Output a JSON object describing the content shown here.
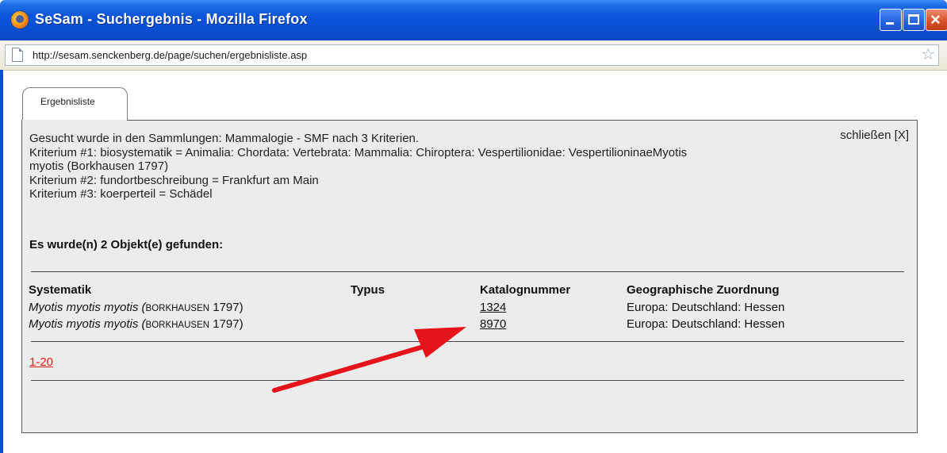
{
  "window": {
    "title": "SeSam - Suchergebnis - Mozilla Firefox",
    "url": "http://sesam.senckenberg.de/page/suchen/ergebnisliste.asp"
  },
  "tab": {
    "label": "Ergebnisliste"
  },
  "panel": {
    "close_label": "schließen [X]",
    "criteria": [
      "Gesucht wurde in den Sammlungen: Mammalogie - SMF nach 3 Kriterien.",
      "Kriterium #1: biosystematik = Animalia: Chordata: Vertebrata: Mammalia: Chiroptera: Vespertilionidae: VespertilioninaeMyotis",
      "myotis (Borkhausen 1797)",
      "Kriterium #2: fundortbeschreibung = Frankfurt am Main",
      "Kriterium #3: koerperteil = Schädel"
    ],
    "found_text": "Es wurde(n) 2 Objekt(e) gefunden:"
  },
  "table": {
    "headers": [
      "Systematik",
      "Typus",
      "Katalognummer",
      "Geographische Zuordnung"
    ],
    "rows": [
      {
        "species": "Myotis myotis myotis",
        "author": "Borkhausen",
        "year": "1797)",
        "typus": "",
        "catalog": "1324",
        "geo": "Europa: Deutschland: Hessen"
      },
      {
        "species": "Myotis myotis myotis",
        "author": "Borkhausen",
        "year": "1797)",
        "typus": "",
        "catalog": "8970",
        "geo": "Europa: Deutschland: Hessen"
      }
    ]
  },
  "pager": {
    "label": "1-20"
  },
  "colors": {
    "titlebar": "#0a55d8",
    "panel_bg": "#ececec",
    "pager_link": "#e0201a",
    "annotation_arrow": "#e5141b"
  },
  "icons": [
    "firefox-icon",
    "minimize-icon",
    "maximize-icon",
    "close-icon",
    "page-icon",
    "bookmark-star-icon",
    "annotation-arrow"
  ]
}
